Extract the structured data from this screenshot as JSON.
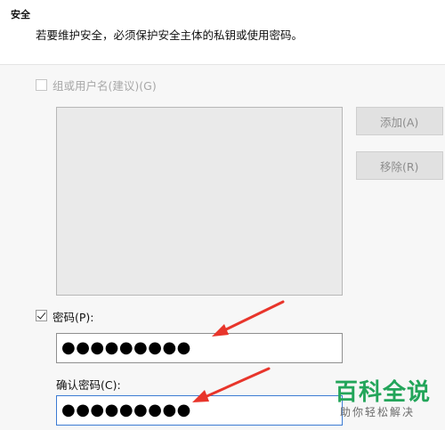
{
  "section": {
    "title": "安全",
    "description": "若要维护安全，必须保护安全主体的私钥或使用密码。"
  },
  "group_option": {
    "label": "组或用户名(建议)(G)",
    "checked": false,
    "enabled": false
  },
  "buttons": {
    "add_label": "添加(A)",
    "remove_label": "移除(R)"
  },
  "password": {
    "label": "密码(P):",
    "checked": true,
    "masked_value": "●●●●●●●●●"
  },
  "confirm_password": {
    "label": "确认密码(C):",
    "masked_value": "●●●●●●●●●"
  },
  "annotation": {
    "arrow_color": "#e8352b"
  },
  "watermark": {
    "title": "百科全说",
    "subtitle": "助你轻松解决"
  }
}
